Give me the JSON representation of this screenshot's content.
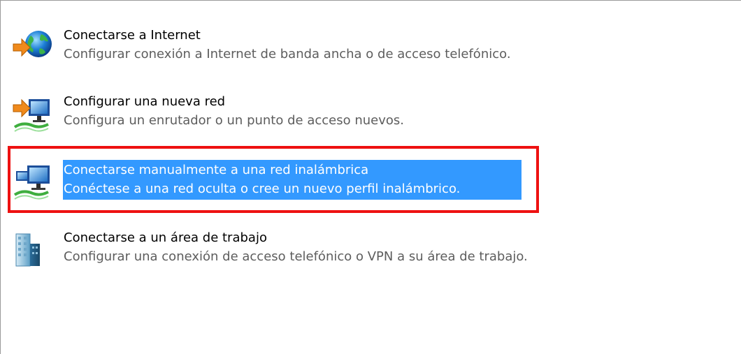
{
  "options": [
    {
      "title": "Conectarse a Internet",
      "description": "Configurar conexión a Internet de banda ancha o de acceso telefónico.",
      "icon": "globe-internet-icon"
    },
    {
      "title": "Configurar una nueva red",
      "description": "Configura un enrutador o un punto de acceso nuevos.",
      "icon": "new-network-icon"
    },
    {
      "title": "Conectarse manualmente a una red inalámbrica",
      "description": "Conéctese a una red oculta o cree un nuevo perfil inalámbrico.",
      "icon": "wireless-network-icon",
      "selected": true
    },
    {
      "title": "Conectarse a un área de trabajo",
      "description": "Configurar una conexión de acceso telefónico o VPN a su área de trabajo.",
      "icon": "workplace-vpn-icon"
    }
  ],
  "colors": {
    "selection": "#3399ff",
    "annotation_border": "#ee1111",
    "description_text": "#5d5d5d"
  }
}
